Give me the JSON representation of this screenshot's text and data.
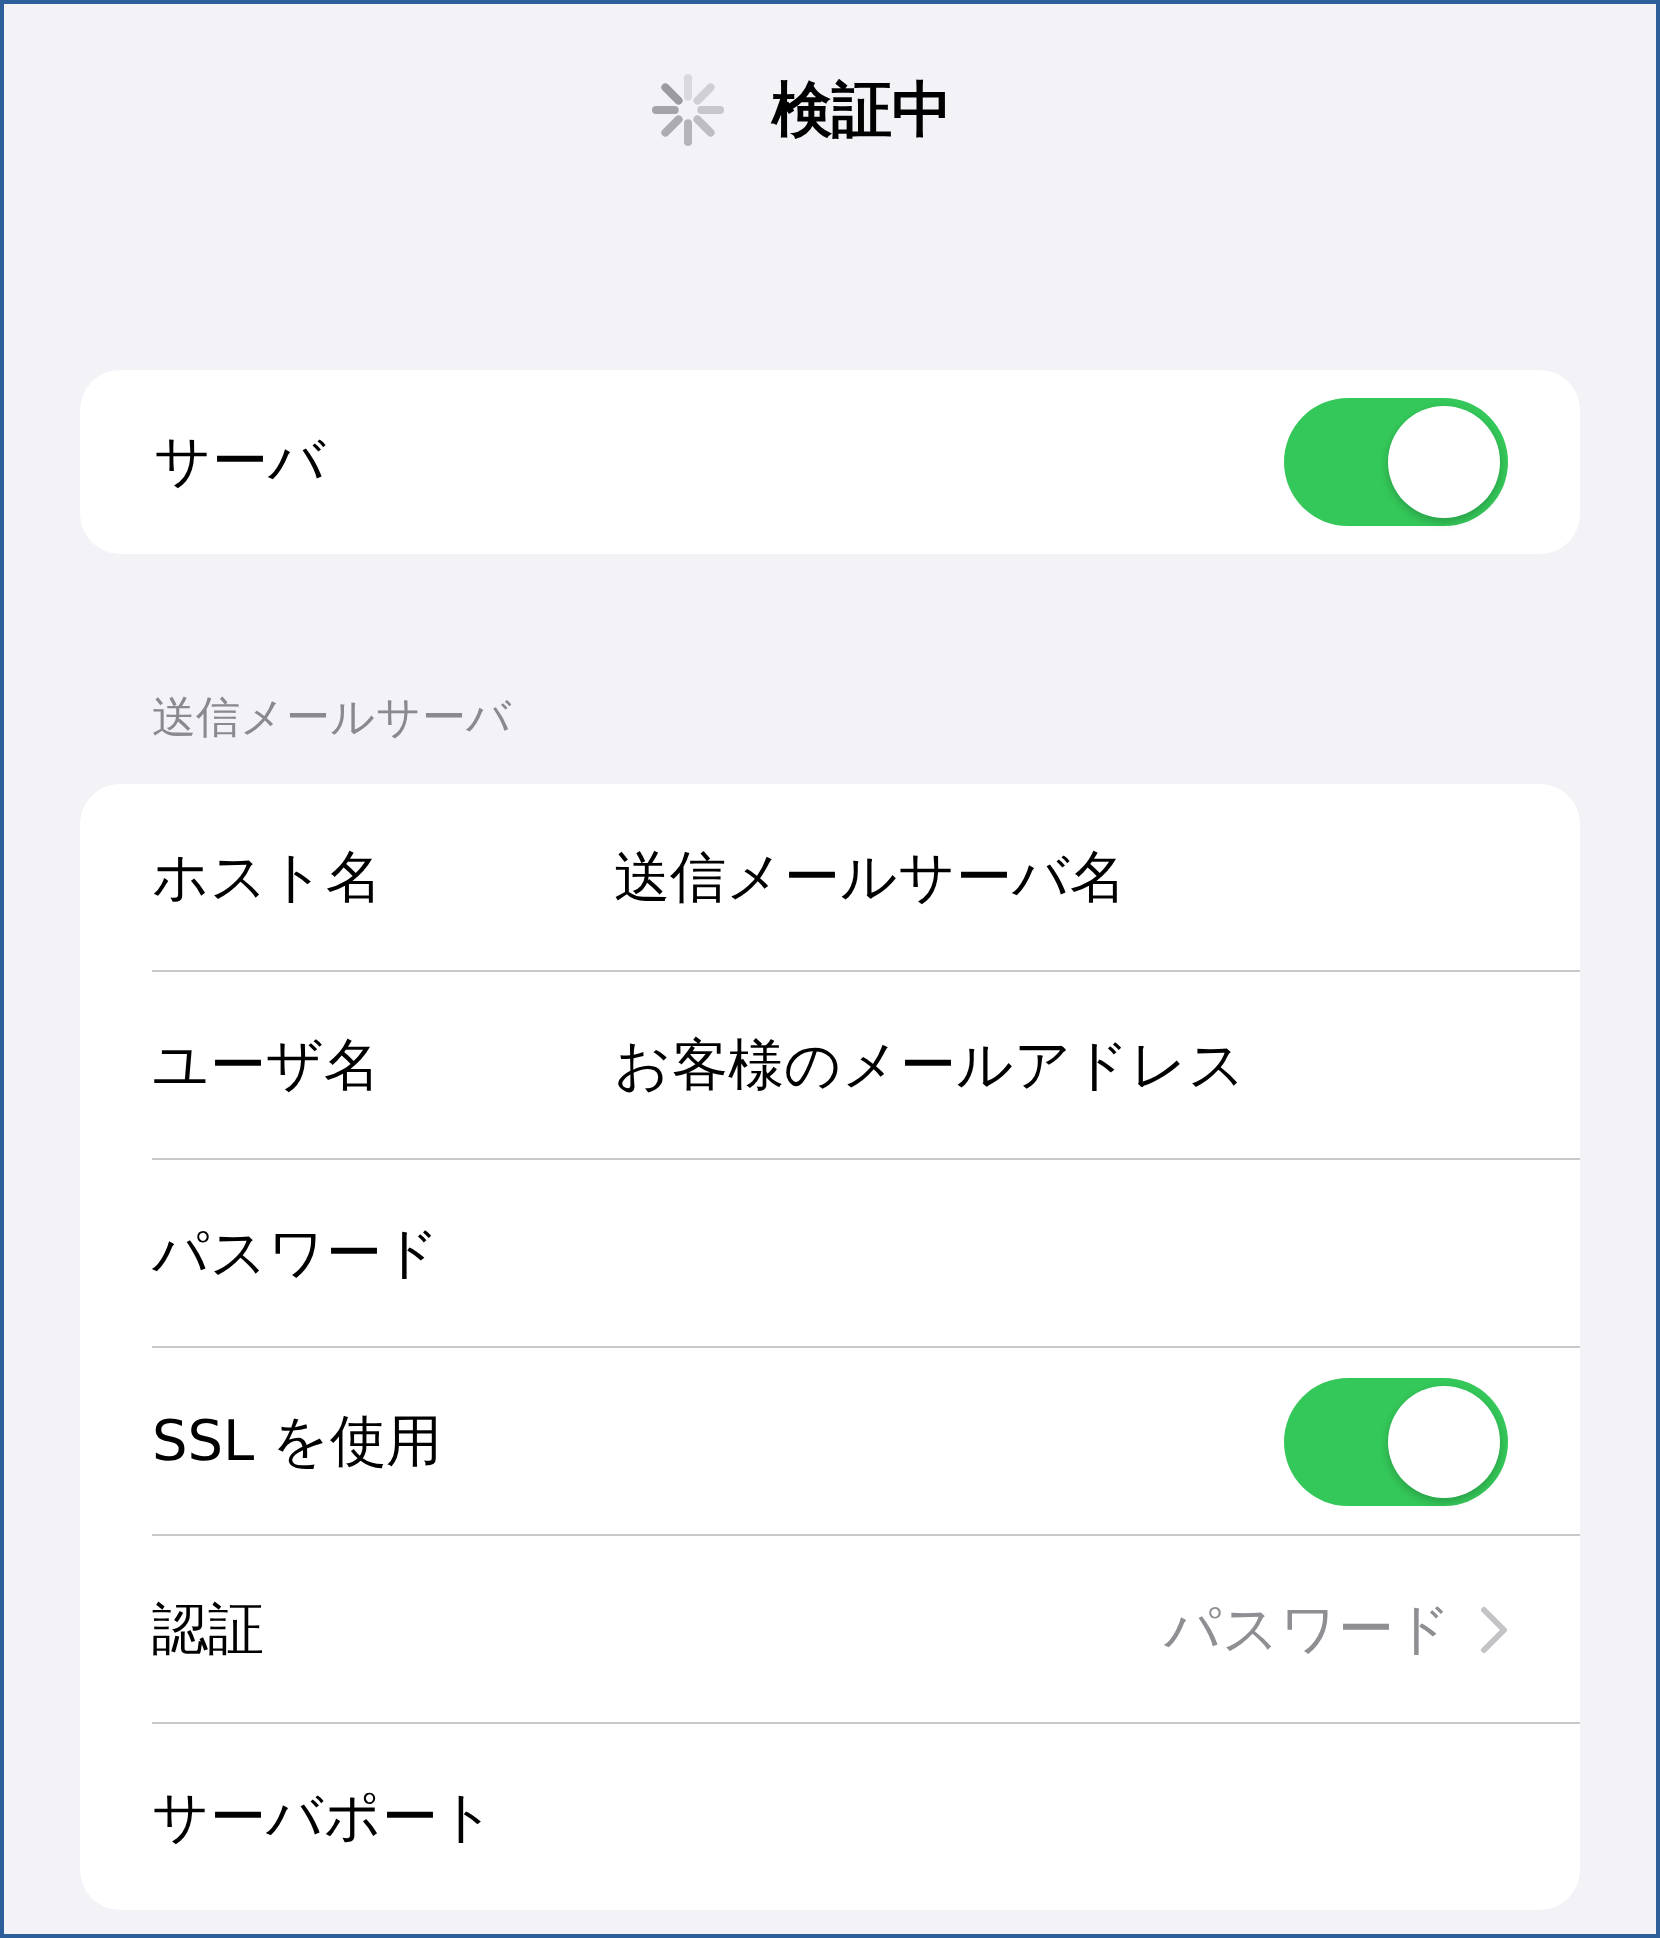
{
  "navigation_bar": {
    "title": "検証中",
    "loading": true
  },
  "server_card": {
    "label": "サーバ",
    "on": true
  },
  "section": {
    "header": "送信メールサーバ",
    "rows": [
      {
        "kind": "text",
        "label": "ホスト名",
        "value": "送信メールサーバ名"
      },
      {
        "kind": "text",
        "label": "ユーザ名",
        "value": "お客様のメールアドレス"
      },
      {
        "kind": "text",
        "label": "パスワード"
      },
      {
        "kind": "toggle",
        "label": "SSL を使用",
        "on": true
      },
      {
        "kind": "link",
        "label": "認証",
        "value": "パスワード"
      },
      {
        "kind": "text",
        "label": "サーバポート"
      }
    ]
  }
}
